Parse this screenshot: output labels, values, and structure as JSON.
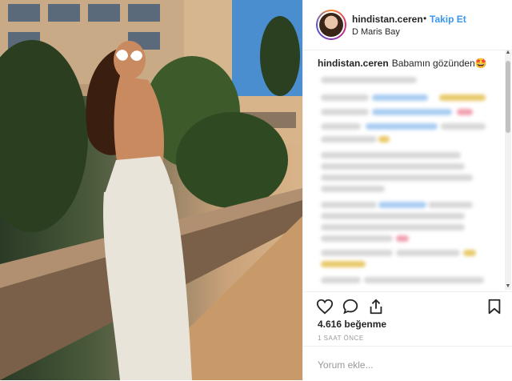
{
  "post": {
    "username": "hindistan.ceren",
    "separator": "•",
    "follow_label": "Takip Et",
    "location": "D Maris Bay",
    "caption_user": "hindistan.ceren",
    "caption_text": "Babamın gözünden🤩"
  },
  "actions": {
    "like_icon": "heart-icon",
    "comment_icon": "comment-icon",
    "share_icon": "share-icon",
    "save_icon": "bookmark-icon"
  },
  "likes_label": "4.616 beğenme",
  "time_label": "1 SAAT ÖNCE",
  "comment_placeholder": "Yorum ekle...",
  "colors": {
    "link_blue": "#3897f0",
    "text": "#262626",
    "muted": "#999999",
    "border": "#efefef"
  }
}
